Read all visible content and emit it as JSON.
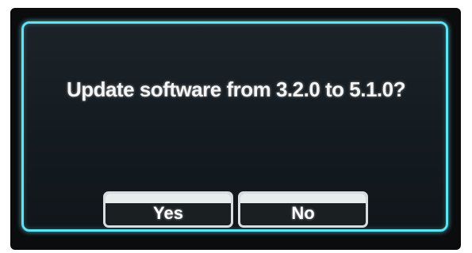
{
  "dialog": {
    "message": "Update software from 3.2.0  to 5.1.0?",
    "yes_label": "Yes",
    "no_label": "No"
  },
  "colors": {
    "frame_accent": "#5fe3f2",
    "background": "#141b20",
    "text": "#f4f4f4"
  }
}
